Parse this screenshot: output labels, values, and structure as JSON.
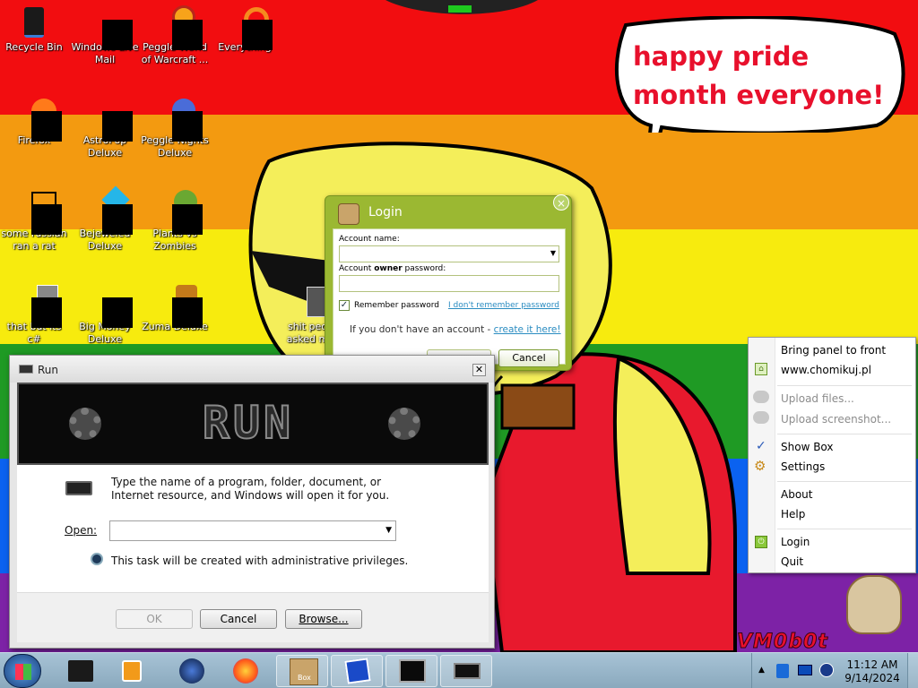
{
  "desktop": {
    "icons": [
      {
        "label": "Recycle Bin"
      },
      {
        "label": "Windows Live Mail"
      },
      {
        "label": "Peggle World of Warcraft ..."
      },
      {
        "label": "Everything"
      },
      {
        "label": "Firefox"
      },
      {
        "label": "AstroPop Deluxe"
      },
      {
        "label": "Peggle Nights Deluxe"
      },
      {
        "label": "some russian ran a rat"
      },
      {
        "label": "Bejeweled Deluxe"
      },
      {
        "label": "Plants vs Zombies"
      },
      {
        "label": "that but its c#"
      },
      {
        "label": "Big Money Deluxe"
      },
      {
        "label": "Zuma Deluxe"
      },
      {
        "label": "shit peo asked m"
      }
    ],
    "bubble_text": "happy pride month everyone!",
    "watermark": "VM0b0t"
  },
  "login_window": {
    "title": "Login",
    "close_glyph": "×",
    "account_name_label": "Account name:",
    "password_label_pre": "Account ",
    "password_label_bold": "owner",
    "password_label_post": " password:",
    "remember_label": "Remember password",
    "remember_checked": true,
    "forgot_link": "I don't remember password",
    "no_account_text": "If you don't have an account - ",
    "create_link": "create it here!",
    "cancel_button": "Cancel"
  },
  "run_dialog": {
    "title": "Run",
    "banner_text": "RUN",
    "description": "Type the name of a program, folder, document, or Internet resource, and Windows will open it for you.",
    "open_label": "Open:",
    "open_value": "",
    "admin_note": "This task will be created with administrative privileges.",
    "ok_button": "OK",
    "cancel_button": "Cancel",
    "browse_button": "Browse..."
  },
  "context_menu": {
    "items": [
      {
        "label": "Bring panel to front",
        "enabled": true,
        "icon": ""
      },
      {
        "label": "www.chomikuj.pl",
        "enabled": true,
        "icon": "home-icon"
      },
      {
        "label": "Upload files...",
        "enabled": false,
        "icon": "upload-icon"
      },
      {
        "label": "Upload screenshot...",
        "enabled": false,
        "icon": "upload-icon"
      },
      {
        "label": "Show Box",
        "enabled": true,
        "icon": "check-icon"
      },
      {
        "label": "Settings",
        "enabled": true,
        "icon": "gear-icon"
      },
      {
        "label": "About",
        "enabled": true,
        "icon": ""
      },
      {
        "label": "Help",
        "enabled": true,
        "icon": ""
      },
      {
        "label": "Login",
        "enabled": true,
        "icon": "power-icon"
      },
      {
        "label": "Quit",
        "enabled": true,
        "icon": ""
      }
    ]
  },
  "taskbar": {
    "pinned": [
      {
        "name": "start-button"
      },
      {
        "name": "computer"
      },
      {
        "name": "media-player"
      },
      {
        "name": "globe"
      },
      {
        "name": "firefox"
      },
      {
        "name": "chomikbox"
      },
      {
        "name": "notepad"
      },
      {
        "name": "task-monitor"
      },
      {
        "name": "run"
      }
    ],
    "box_label": "Box",
    "clock_time": "11:12 AM",
    "clock_date": "9/14/2024"
  },
  "colors": {
    "red": "#f20d10",
    "orange": "#f39a10",
    "yellow": "#f7eb0e",
    "green": "#1f9a24",
    "blue": "#0b62f0",
    "purple": "#7d22a6",
    "login_green": "#9bb832"
  }
}
